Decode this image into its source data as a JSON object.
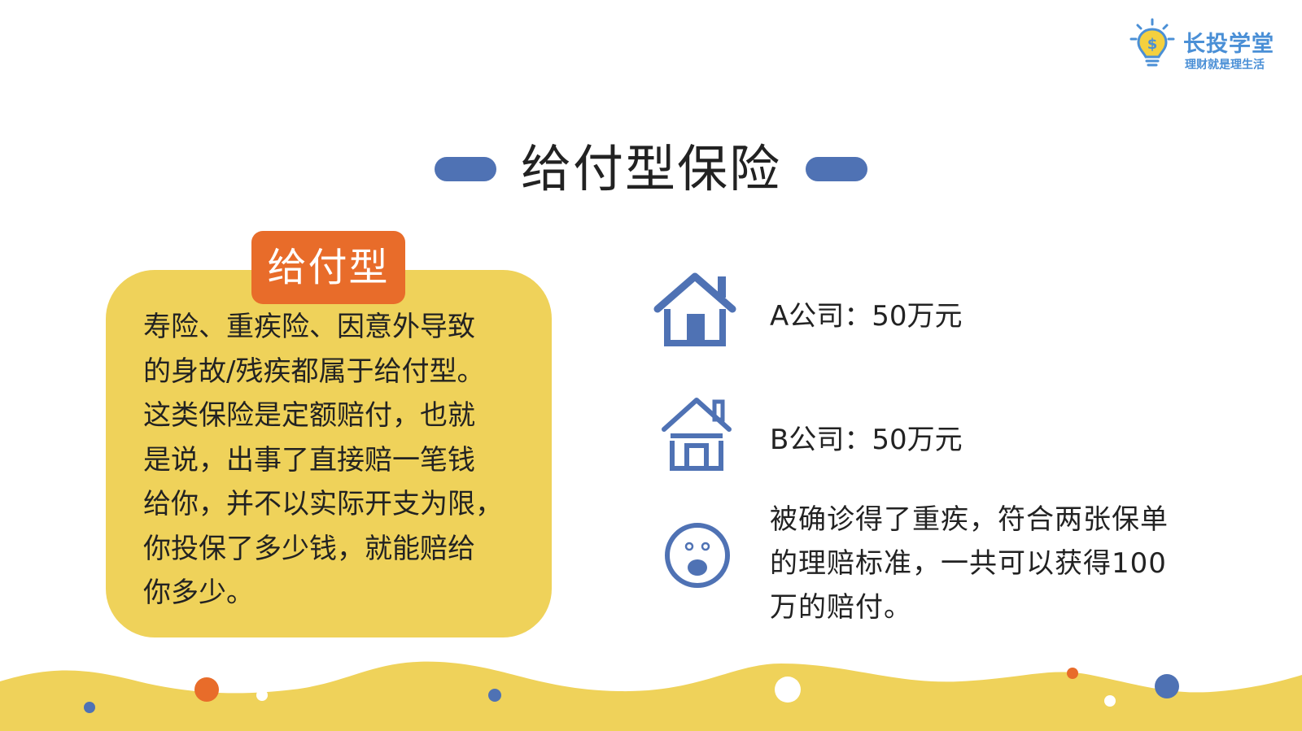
{
  "logo": {
    "brand": "长投学堂",
    "slogan": "理财就是理生活",
    "icon": "lightbulb-dollar-icon"
  },
  "title": "给付型保险",
  "card": {
    "tag": "给付型",
    "lines": [
      "寿险、重疾险、因意外导致",
      "的身故/残疾都属于给付型。",
      "这类保险是定额赔付，也就",
      "是说，出事了直接赔一笔钱",
      "给你，并不以实际开支为限，",
      "你投保了多少钱，就能赔给",
      "你多少。"
    ]
  },
  "items": [
    {
      "icon": "house-icon",
      "text": "A公司：50万元"
    },
    {
      "icon": "house-outline-icon",
      "text": "B公司：50万元"
    },
    {
      "icon": "shocked-face-icon",
      "lines": [
        "被确诊得了重疾，符合两张保单",
        "的理赔标准，一共可以获得100",
        "万的赔付。"
      ]
    }
  ],
  "colors": {
    "accent_blue": "#4f72b4",
    "card_yellow": "#efd25a",
    "tag_orange": "#e86c2a",
    "logo_blue": "#4a8fd6"
  }
}
